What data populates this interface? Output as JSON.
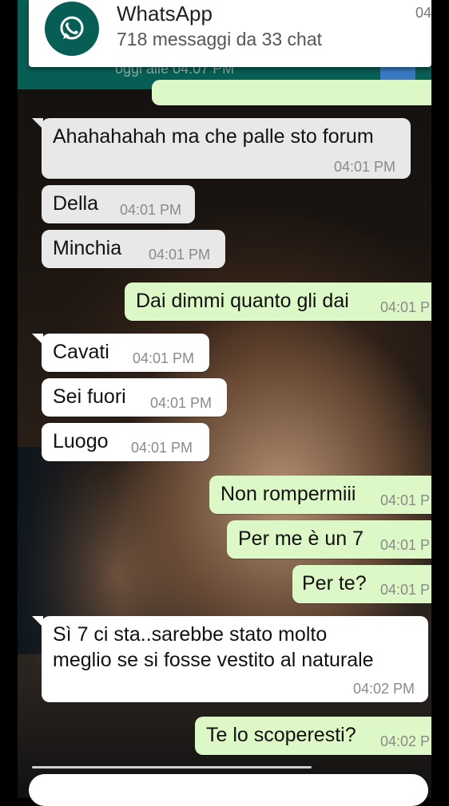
{
  "notification": {
    "app_name": "WhatsApp",
    "summary": "718 messaggi da 33 chat",
    "time": "04"
  },
  "header": {
    "subtitle": "oggi alle 04:07 PM"
  },
  "messages": [
    {
      "text": "Ahahahahah ma che palle sto forum",
      "time": "04:01 PM",
      "dir": "in"
    },
    {
      "text": "Della",
      "time": "04:01 PM",
      "dir": "in"
    },
    {
      "text": "Minchia",
      "time": "04:01 PM",
      "dir": "in"
    },
    {
      "text": "Dai dimmi quanto gli dai",
      "time": "04:01 P",
      "dir": "out"
    },
    {
      "text": "Cavati",
      "time": "04:01 PM",
      "dir": "in"
    },
    {
      "text": "Sei fuori",
      "time": "04:01 PM",
      "dir": "in"
    },
    {
      "text": "Luogo",
      "time": "04:01 PM",
      "dir": "in"
    },
    {
      "text": "Non rompermiii",
      "time": "04:01 P",
      "dir": "out"
    },
    {
      "text": "Per me è un 7",
      "time": "04:01 P",
      "dir": "out"
    },
    {
      "text": "Per te?",
      "time": "04:01 P",
      "dir": "out"
    },
    {
      "text": "Sì 7 ci sta..sarebbe stato molto meglio se si fosse vestito al naturale",
      "line1": "Sì 7 ci sta..sarebbe stato molto",
      "line2": "meglio se si fosse vestito al naturale",
      "time": "04:02 PM",
      "dir": "in"
    },
    {
      "text": "Te lo scoperesti?",
      "time": "04:02 P",
      "dir": "out"
    }
  ],
  "colors": {
    "header": "#075e54",
    "incoming": "#ffffff",
    "outgoing": "#dcf8c6"
  }
}
